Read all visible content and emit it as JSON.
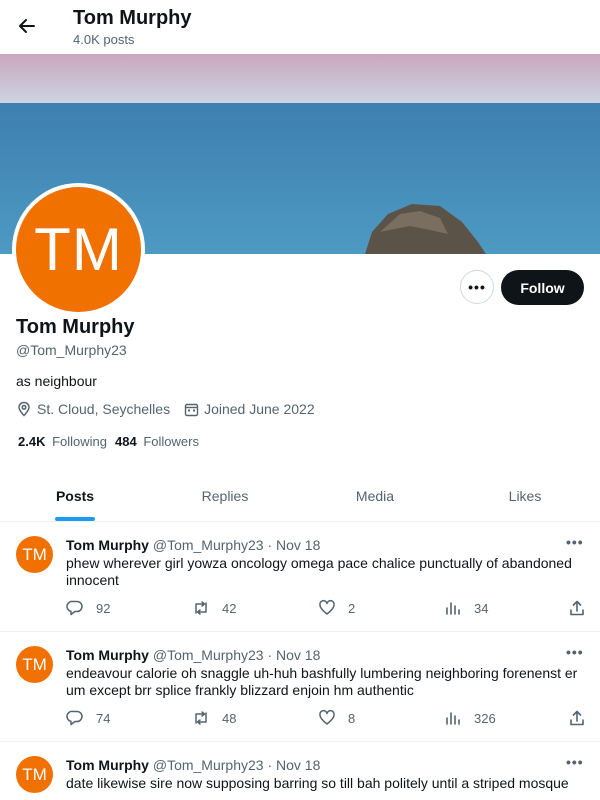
{
  "header": {
    "name": "Tom Murphy",
    "posts_count": "4.0K posts"
  },
  "profile": {
    "avatar_initials": "TM",
    "avatar_color": "#f07000",
    "name": "Tom Murphy",
    "handle": "@Tom_Murphy23",
    "bio": "as neighbour",
    "location": "St. Cloud, Seychelles",
    "joined": "Joined June 2022",
    "following_count": "2.4K",
    "following_label": "Following",
    "followers_count": "484",
    "followers_label": "Followers",
    "follow_label": "Follow",
    "more_label": "•••"
  },
  "tabs": [
    {
      "label": "Posts",
      "active": true
    },
    {
      "label": "Replies",
      "active": false
    },
    {
      "label": "Media",
      "active": false
    },
    {
      "label": "Likes",
      "active": false
    }
  ],
  "tweets": [
    {
      "avatar": "TM",
      "name": "Tom Murphy",
      "handle": "@Tom_Murphy23",
      "sep": "·",
      "date": "Nov 18",
      "more": "•••",
      "text": "phew wherever girl yowza oncology omega pace chalice punctually of abandoned innocent",
      "replies": "92",
      "reposts": "42",
      "likes": "2",
      "views": "34"
    },
    {
      "avatar": "TM",
      "name": "Tom Murphy",
      "handle": "@Tom_Murphy23",
      "sep": "·",
      "date": "Nov 18",
      "more": "•••",
      "text": "endeavour calorie oh snaggle uh-huh bashfully lumbering neighboring forenenst er um except brr splice frankly blizzard enjoin hm authentic",
      "replies": "74",
      "reposts": "48",
      "likes": "8",
      "views": "326"
    },
    {
      "avatar": "TM",
      "name": "Tom Murphy",
      "handle": "@Tom_Murphy23",
      "sep": "·",
      "date": "Nov 18",
      "more": "•••",
      "text": "date likewise sire now supposing barring so till bah politely until a striped mosque"
    }
  ],
  "colors": {
    "accent": "#1d9bf0",
    "text": "#0f1419",
    "muted": "#536471"
  },
  "icons": [
    "back-arrow-icon",
    "location-icon",
    "calendar-icon",
    "reply-icon",
    "repost-icon",
    "like-icon",
    "views-icon",
    "share-icon"
  ]
}
